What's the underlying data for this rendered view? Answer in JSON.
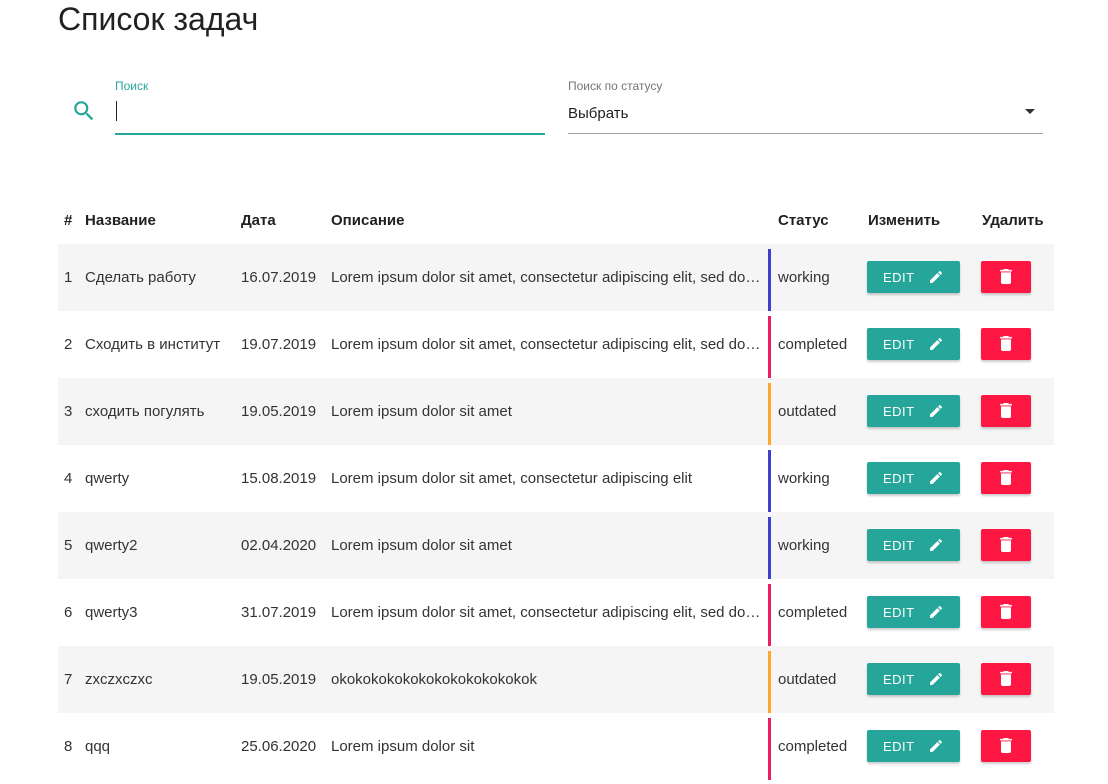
{
  "page": {
    "title": "Список задач"
  },
  "search": {
    "label": "Поиск",
    "value": "",
    "placeholder": ""
  },
  "status_filter": {
    "label": "Поиск по статусу",
    "selected": "Выбрать"
  },
  "colors": {
    "accent": "#26a69a",
    "delete": "#ff1744",
    "status_working": "#3f3fcf",
    "status_completed": "#e91e63",
    "status_outdated": "#ffa726"
  },
  "table": {
    "headers": {
      "num": "#",
      "name": "Название",
      "date": "Дата",
      "description": "Описание",
      "status": "Статус",
      "edit": "Изменить",
      "delete": "Удалить"
    },
    "edit_label": "EDIT",
    "rows": [
      {
        "num": "1",
        "name": "Сделать работу",
        "date": "16.07.2019",
        "description": "Lorem ipsum dolor sit amet, consectetur adipiscing elit, sed do eiusmod",
        "status": "working"
      },
      {
        "num": "2",
        "name": "Сходить в институт",
        "date": "19.07.2019",
        "description": "Lorem ipsum dolor sit amet, consectetur adipiscing elit, sed do eiusmod",
        "status": "completed"
      },
      {
        "num": "3",
        "name": "сходить погулять",
        "date": "19.05.2019",
        "description": "Lorem ipsum dolor sit amet",
        "status": "outdated"
      },
      {
        "num": "4",
        "name": "qwerty",
        "date": "15.08.2019",
        "description": "Lorem ipsum dolor sit amet, consectetur adipiscing elit",
        "status": "working"
      },
      {
        "num": "5",
        "name": "qwerty2",
        "date": "02.04.2020",
        "description": "Lorem ipsum dolor sit amet",
        "status": "working"
      },
      {
        "num": "6",
        "name": "qwerty3",
        "date": "31.07.2019",
        "description": "Lorem ipsum dolor sit amet, consectetur adipiscing elit, sed do eiusmod",
        "status": "completed"
      },
      {
        "num": "7",
        "name": "zxczxczxc",
        "date": "19.05.2019",
        "description": "okokokokokokokokokokokokok",
        "status": "outdated"
      },
      {
        "num": "8",
        "name": "qqq",
        "date": "25.06.2020",
        "description": "Lorem ipsum dolor sit",
        "status": "completed"
      }
    ]
  }
}
